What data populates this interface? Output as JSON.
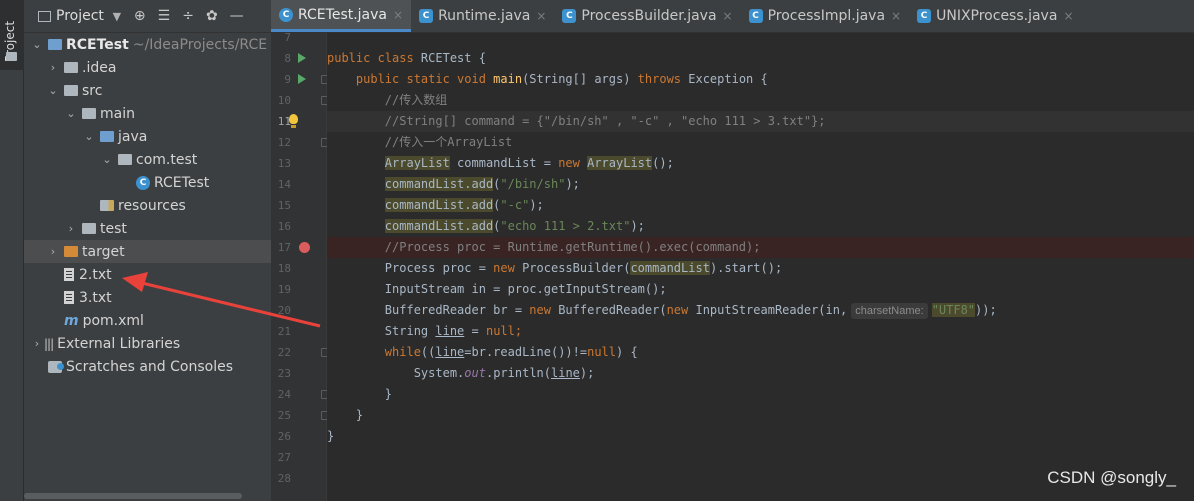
{
  "tool_strip": {
    "project_tab_label": "Project"
  },
  "panel": {
    "title": "Project",
    "tools": [
      "⊕",
      "☰",
      "÷",
      "✿",
      "—"
    ]
  },
  "tree": {
    "root_label": "RCETest",
    "root_path": "~/IdeaProjects/RCE",
    "items": [
      {
        "label": ".idea"
      },
      {
        "label": "src"
      },
      {
        "label": "main"
      },
      {
        "label": "java"
      },
      {
        "label": "com.test"
      },
      {
        "label": "RCETest"
      },
      {
        "label": "resources"
      },
      {
        "label": "test"
      },
      {
        "label": "target"
      },
      {
        "label": "2.txt"
      },
      {
        "label": "3.txt"
      },
      {
        "label": "pom.xml"
      },
      {
        "label": "External Libraries"
      },
      {
        "label": "Scratches and Consoles"
      }
    ]
  },
  "tabs": [
    {
      "label": "RCETest.java",
      "icon": "class-icon"
    },
    {
      "label": "Runtime.java",
      "icon": "class-icon"
    },
    {
      "label": "ProcessBuilder.java",
      "icon": "decompiled-class-icon"
    },
    {
      "label": "ProcessImpl.java",
      "icon": "decompiled-class-icon"
    },
    {
      "label": "UNIXProcess.java",
      "icon": "decompiled-class-icon"
    }
  ],
  "gutter": {
    "line_numbers": [
      "7",
      "8",
      "9",
      "10",
      "11",
      "12",
      "13",
      "14",
      "15",
      "16",
      "17",
      "18",
      "19",
      "20",
      "21",
      "22",
      "23",
      "24",
      "25",
      "26",
      "27",
      "28"
    ]
  },
  "code": {
    "l8_a": "public class ",
    "l8_b": "RCETest {",
    "l9_a": "    public static void ",
    "l9_b": "main",
    "l9_c": "(String[] args) ",
    "l9_d": "throws ",
    "l9_e": "Exception {",
    "l10": "        //传入数组",
    "l11": "        //String[] command = {\"/bin/sh\" , \"-c\" , \"echo 111 > 3.txt\"};",
    "l12": "        //传入一个ArrayList",
    "l13_a": "        ",
    "l13_b": "ArrayList",
    "l13_c": " commandList = ",
    "l13_d": "new ",
    "l13_e": "ArrayList",
    "l13_f": "();",
    "l14_a": "        ",
    "l14_b": "commandList.add",
    "l14_c": "(",
    "l14_d": "\"/bin/sh\"",
    "l14_e": ");",
    "l15_a": "        ",
    "l15_b": "commandList.add",
    "l15_c": "(",
    "l15_d": "\"-c\"",
    "l15_e": ");",
    "l16_a": "        ",
    "l16_b": "commandList.add",
    "l16_c": "(",
    "l16_d": "\"echo 111 > 2.txt\"",
    "l16_e": ");",
    "l17": "        //Process proc = Runtime.getRuntime().exec(command);",
    "l18_a": "        Process proc = ",
    "l18_b": "new ",
    "l18_c": "ProcessBuilder(",
    "l18_d": "commandList",
    "l18_e": ").start();",
    "l19": "        InputStream in = proc.getInputStream();",
    "l20_a": "        BufferedReader br = ",
    "l20_b": "new ",
    "l20_c": "BufferedReader(",
    "l20_d": "new ",
    "l20_e": "InputStreamReader(in,",
    "l20_hint": "charsetName:",
    "l20_f": "\"UTF8\"",
    "l20_g": "));",
    "l21_a": "        String ",
    "l21_b": "line",
    "l21_c": " = ",
    "l21_d": "null",
    "l21_e": ";",
    "l22_a": "        ",
    "l22_b": "while",
    "l22_c": "((",
    "l22_d": "line",
    "l22_e": "=br.readLine())!=",
    "l22_f": "null",
    "l22_g": ") {",
    "l23_a": "            System.",
    "l23_b": "out",
    "l23_c": ".println(",
    "l23_d": "line",
    "l23_e": ");",
    "l24": "        }",
    "l25": "    }",
    "l26": "}"
  },
  "watermark": "CSDN @songly_",
  "colors": {
    "keyword": "#cc7832",
    "comment": "#808080",
    "string": "#6a8759",
    "method": "#ffc66d",
    "breakpoint": "#db5c5c",
    "arrow": "#e8423b"
  }
}
